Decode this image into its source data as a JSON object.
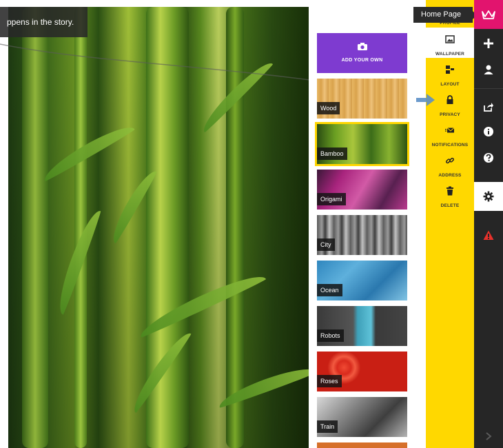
{
  "story_tooltip": {
    "text": "ppens in the story."
  },
  "home_tooltip": {
    "text": "Home Page"
  },
  "add_your_own": {
    "label": "ADD YOUR OWN"
  },
  "wallpapers": [
    {
      "label": "Wood",
      "selected": false
    },
    {
      "label": "Bamboo",
      "selected": true
    },
    {
      "label": "Origami",
      "selected": false
    },
    {
      "label": "City",
      "selected": false
    },
    {
      "label": "Ocean",
      "selected": false
    },
    {
      "label": "Robots",
      "selected": false
    },
    {
      "label": "Roses",
      "selected": false
    },
    {
      "label": "Train",
      "selected": false
    }
  ],
  "settings_menu": {
    "items": [
      {
        "label": "PROFILE",
        "icon": "profile-icon"
      },
      {
        "label": "WALLPAPER",
        "icon": "image-icon",
        "active": true
      },
      {
        "label": "LAYOUT",
        "icon": "layout-icon"
      },
      {
        "label": "PRIVACY",
        "icon": "lock-icon"
      },
      {
        "label": "NOTIFICATIONS",
        "icon": "envelope-icon"
      },
      {
        "label": "ADDRESS",
        "icon": "link-icon"
      },
      {
        "label": "DELETE",
        "icon": "trash-icon"
      }
    ]
  },
  "toolbar": {
    "icons": [
      "crown-logo-icon",
      "plus-icon",
      "user-icon",
      "share-icon",
      "info-icon",
      "help-icon",
      "gear-icon",
      "warning-icon",
      "chevron-right-icon"
    ]
  },
  "colors": {
    "menu_yellow": "#ffd800",
    "toolbar_dark": "#262626",
    "logo_pink": "#e2146e",
    "add_purple": "#7e3bd0",
    "warning_red": "#e8312b",
    "arrow_blue": "#5b8fc7"
  }
}
